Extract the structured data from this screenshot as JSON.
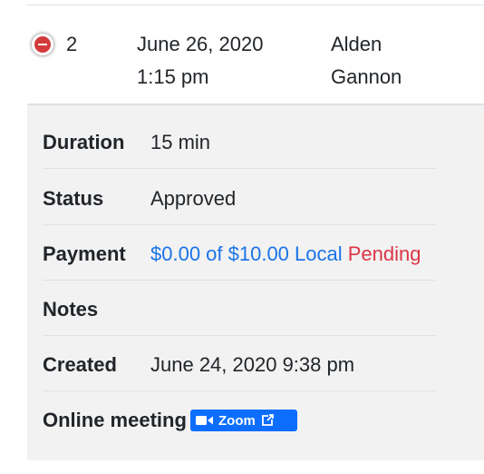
{
  "row": {
    "id": "2",
    "date_line1": "June 26, 2020",
    "date_line2": "1:15 pm",
    "name_line1": "Alden",
    "name_line2": "Gannon"
  },
  "details": {
    "duration": {
      "label": "Duration",
      "value": "15 min"
    },
    "status": {
      "label": "Status",
      "value": "Approved"
    },
    "payment": {
      "label": "Payment",
      "amount": "$0.00 of $10.00 Local",
      "state": "Pending"
    },
    "notes": {
      "label": "Notes",
      "value": ""
    },
    "created": {
      "label": "Created",
      "value": "June 24, 2020 9:38 pm"
    },
    "online_meeting": {
      "label": "Online meeting",
      "button_label": "Zoom"
    }
  },
  "colors": {
    "link_blue": "#1a73e8",
    "pending_red": "#dc3545",
    "zoom_blue": "#0d6efd",
    "collapse_red": "#d33a3a"
  },
  "icons": {
    "collapse": "minus-circle-icon",
    "zoom": "video-camera-icon",
    "external": "external-link-icon"
  }
}
